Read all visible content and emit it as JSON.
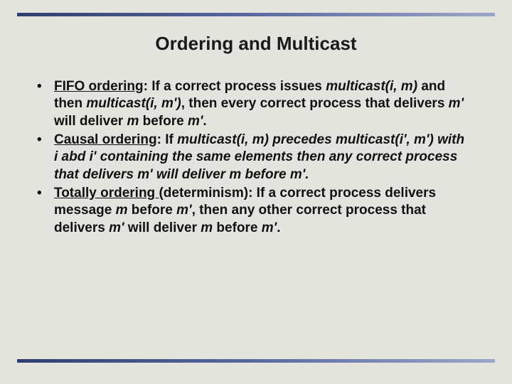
{
  "title": "Ordering and Multicast",
  "bullets": [
    {
      "term": "FIFO ordering",
      "sep": ": If a correct process issues ",
      "ital1": "multicast(i, m)",
      "mid1": " and then ",
      "ital2": "multicast(i, m')",
      "mid2": ", then every correct process that delivers ",
      "ital3": "m'",
      "mid3": " will deliver ",
      "ital4": "m",
      "mid4": " before ",
      "ital5": "m'",
      "end": "."
    },
    {
      "term": "Causal ordering",
      "sep": ": If ",
      "ital1": "multicast(i, m) precedes multicast(i', m') with i abd i' containing the same elements then any correct process that delivers m' will deliver m before m'.",
      "mid1": "",
      "ital2": "",
      "mid2": "",
      "ital3": "",
      "mid3": "",
      "ital4": "",
      "mid4": "",
      "ital5": "",
      "end": ""
    },
    {
      "term": "Totally ordering ",
      "sep": "(determinism): If a correct process delivers message ",
      "ital1": "m",
      "mid1": " before ",
      "ital2": "m'",
      "mid2": ", then any other correct process that delivers ",
      "ital3": "m'",
      "mid3": " will deliver ",
      "ital4": "m",
      "mid4": " before ",
      "ital5": "m'",
      "end": "."
    }
  ]
}
